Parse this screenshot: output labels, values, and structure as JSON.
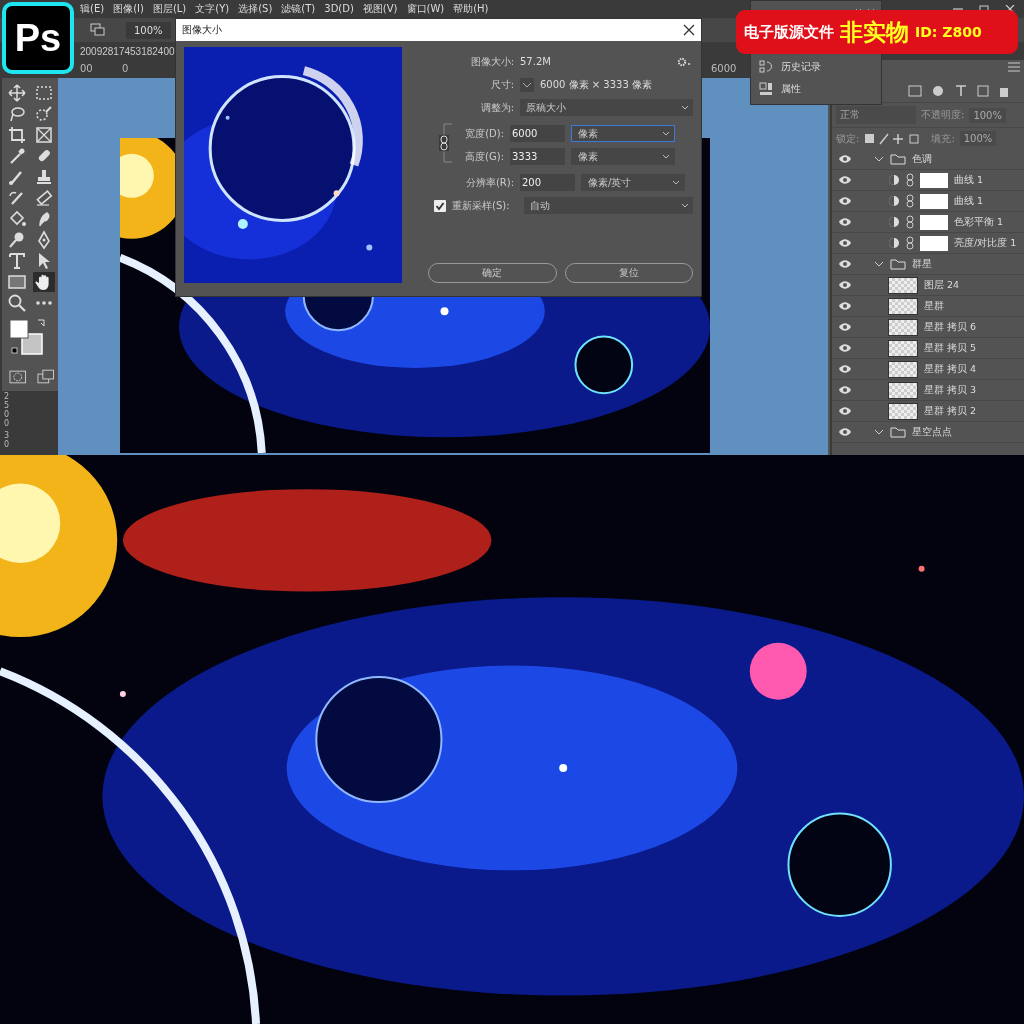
{
  "logo": {
    "text": "Ps"
  },
  "menu": [
    "辑(E)",
    "图像(I)",
    "图层(L)",
    "文字(Y)",
    "选择(S)",
    "滤镜(T)",
    "3D(D)",
    "视图(V)",
    "窗口(W)",
    "帮助(H)"
  ],
  "options_bar": {
    "zoom": "100%"
  },
  "document_tab": {
    "title": "20092817453182400"
  },
  "ruler": {
    "top_marks": [
      "00",
      "0",
      "6000"
    ],
    "side_marks": [
      "2500",
      "30"
    ]
  },
  "toolbar": [
    {
      "kind": "move",
      "selected": false
    },
    {
      "kind": "marquee",
      "selected": false
    },
    {
      "kind": "lasso",
      "selected": false
    },
    {
      "kind": "quick-select",
      "selected": false
    },
    {
      "kind": "crop",
      "selected": false
    },
    {
      "kind": "frame",
      "selected": false
    },
    {
      "kind": "eyedropper",
      "selected": false
    },
    {
      "kind": "bandage",
      "selected": false
    },
    {
      "kind": "brush",
      "selected": false
    },
    {
      "kind": "stamp",
      "selected": false
    },
    {
      "kind": "history-brush",
      "selected": false
    },
    {
      "kind": "eraser",
      "selected": false
    },
    {
      "kind": "bucket",
      "selected": false
    },
    {
      "kind": "smudge",
      "selected": false
    },
    {
      "kind": "dodge",
      "selected": false
    },
    {
      "kind": "pen",
      "selected": false
    },
    {
      "kind": "type",
      "selected": false
    },
    {
      "kind": "pointer",
      "selected": false
    },
    {
      "kind": "rectangle",
      "selected": false
    },
    {
      "kind": "hand",
      "selected": true
    },
    {
      "kind": "zoom",
      "selected": false
    },
    {
      "kind": "more",
      "selected": false
    }
  ],
  "dialog": {
    "title": "图像大小",
    "image_size_label": "图像大小:",
    "image_size": "57.2M",
    "dimensions_label": "尺寸:",
    "dimensions": "6000 像素 × 3333 像素",
    "fit_label": "调整为:",
    "fit_value": "原稿大小",
    "fields": [
      {
        "label": "宽度(D):",
        "value": "6000",
        "unit": "像素",
        "focused": true
      },
      {
        "label": "高度(G):",
        "value": "3333",
        "unit": "像素",
        "focused": false
      },
      {
        "label": "分辨率(R):",
        "value": "200",
        "unit": "像素/英寸",
        "focused": false
      }
    ],
    "resample": {
      "label": "重新采样(S):",
      "checked": true,
      "value": "自动"
    },
    "buttons": [
      "确定",
      "复位"
    ]
  },
  "panel_menu": [
    {
      "label": "历史记录"
    },
    {
      "label": "属性"
    }
  ],
  "layers_panel": {
    "blend_mode": "正常",
    "opacity_label": "不透明度:",
    "opacity": "100%",
    "lock_label": "锁定:",
    "fill_label": "填充:",
    "fill": "100%",
    "layers": [
      {
        "name": "色调",
        "kind": "group",
        "visible": true,
        "expanded": true,
        "children": [
          {
            "name": "曲线 1",
            "kind": "adjustment",
            "visible": true
          },
          {
            "name": "曲线 1",
            "kind": "adjustment",
            "visible": true
          },
          {
            "name": "色彩平衡 1",
            "kind": "adjustment",
            "visible": true
          },
          {
            "name": "亮度/对比度 1",
            "kind": "adjustment",
            "visible": true
          }
        ]
      },
      {
        "name": "群星",
        "kind": "group",
        "visible": true,
        "expanded": true,
        "children": [
          {
            "name": "图层 24",
            "kind": "pixel",
            "visible": true
          },
          {
            "name": "星群",
            "kind": "pixel",
            "visible": true
          },
          {
            "name": "星群 拷贝 6",
            "kind": "pixel",
            "visible": true
          },
          {
            "name": "星群 拷贝 5",
            "kind": "pixel",
            "visible": true
          },
          {
            "name": "星群 拷贝 4",
            "kind": "pixel",
            "visible": true
          },
          {
            "name": "星群 拷贝 3",
            "kind": "pixel",
            "visible": true
          },
          {
            "name": "星群 拷贝 2",
            "kind": "pixel",
            "visible": true
          }
        ]
      },
      {
        "name": "星空点点",
        "kind": "group",
        "visible": true,
        "expanded": true
      }
    ]
  },
  "banner": {
    "text": "电子版源文件",
    "highlight": "非实物",
    "id": "ID: Z800"
  }
}
